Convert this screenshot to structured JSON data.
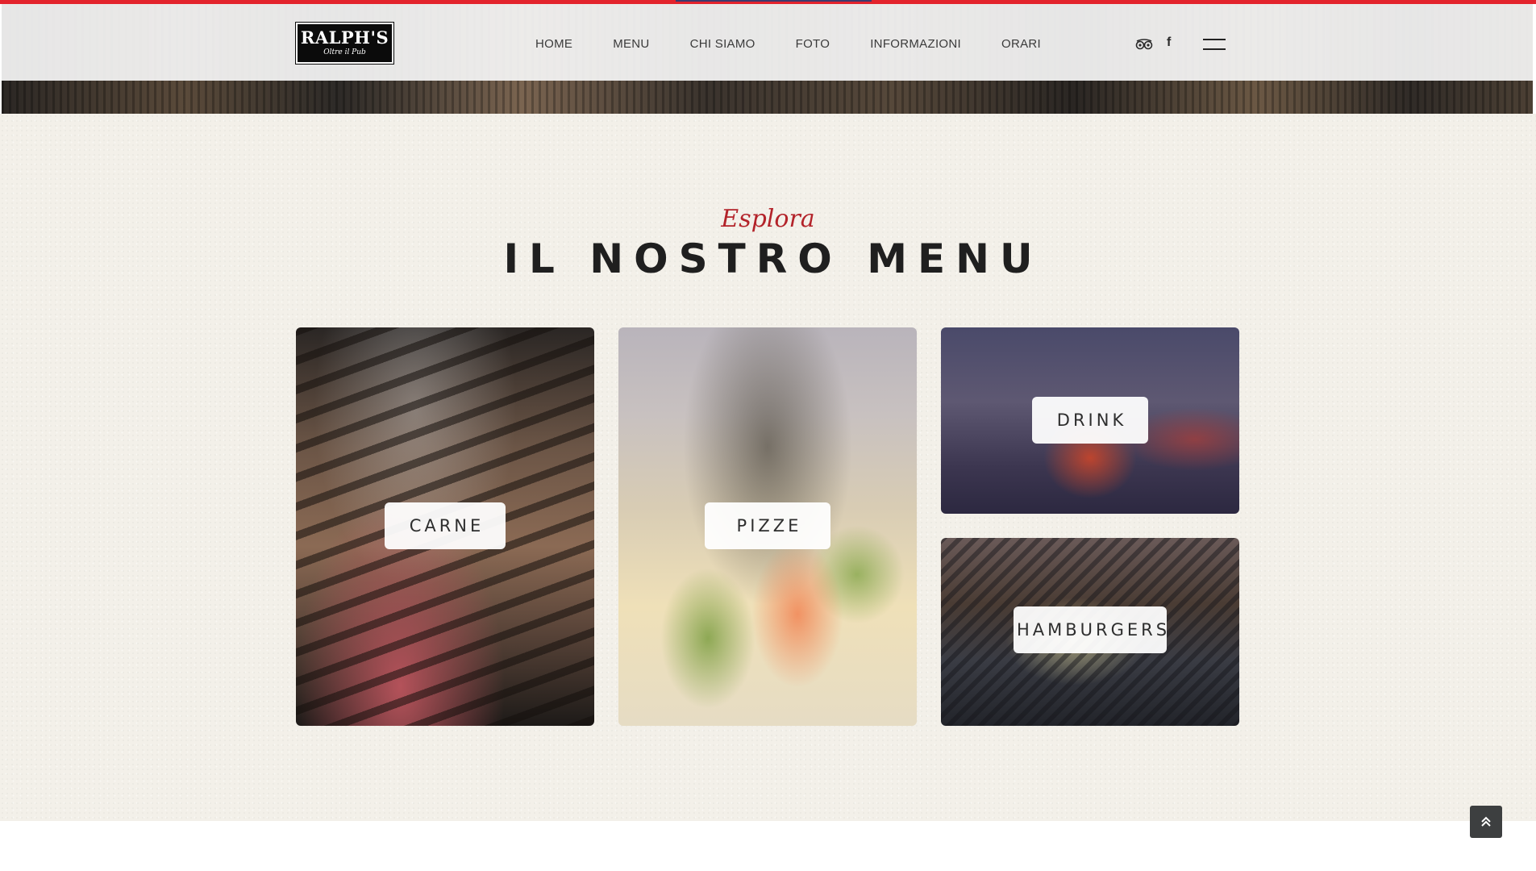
{
  "brand": {
    "name": "RALPH'S",
    "tagline": "Oltre il Pub"
  },
  "nav": {
    "items": [
      {
        "label": "HOME"
      },
      {
        "label": "MENU"
      },
      {
        "label": "CHI SIAMO"
      },
      {
        "label": "FOTO"
      },
      {
        "label": "INFORMAZIONI"
      },
      {
        "label": "ORARI"
      }
    ]
  },
  "header_icons": [
    "tripadvisor-icon",
    "facebook-icon",
    "hamburger-menu-icon"
  ],
  "menu_section": {
    "eyebrow": "Esplora",
    "title": "IL NOSTRO MENU",
    "categories": [
      {
        "label": "CARNE"
      },
      {
        "label": "PIZZE"
      },
      {
        "label": "DRINK"
      },
      {
        "label": "HAMBURGERS"
      }
    ]
  },
  "colors": {
    "accent_red": "#e3232c",
    "eyebrow_red": "#b3232a",
    "section_background": "#f3f0e9",
    "back_to_top": "#3d3f40"
  }
}
